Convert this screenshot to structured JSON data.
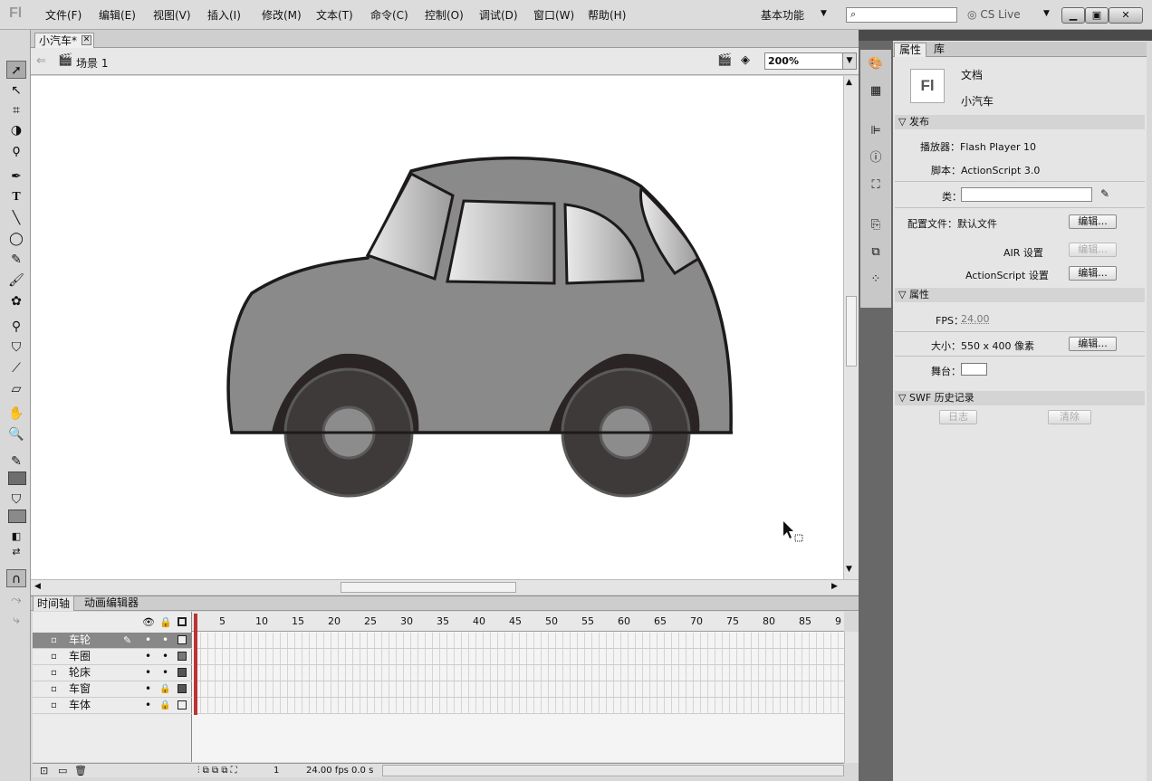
{
  "app": {
    "logo": "Fl"
  },
  "menu": [
    "文件(F)",
    "编辑(E)",
    "视图(V)",
    "插入(I)",
    "修改(M)",
    "文本(T)",
    "命令(C)",
    "控制(O)",
    "调试(D)",
    "窗口(W)",
    "帮助(H)"
  ],
  "workspace": {
    "label": "基本功能"
  },
  "search": {
    "placeholder": ""
  },
  "cslive": "CS Live",
  "document": {
    "tab": "小汽车*",
    "scene": "场景 1",
    "zoom": "200%"
  },
  "timeline": {
    "tabs": [
      "时间轴",
      "动画编辑器"
    ],
    "ruler": [
      "5",
      "10",
      "15",
      "20",
      "25",
      "30",
      "35",
      "40",
      "45",
      "50",
      "55",
      "60",
      "65",
      "70",
      "75",
      "80",
      "85",
      "9"
    ],
    "layers": [
      {
        "name": "车轮",
        "selected": true
      },
      {
        "name": "车圈",
        "selected": false
      },
      {
        "name": "轮床",
        "selected": false
      },
      {
        "name": "车窗",
        "selected": false
      },
      {
        "name": "车体",
        "selected": false
      }
    ],
    "footer": {
      "frame": "1",
      "fps": "24.00 fps",
      "time": "0.0 s"
    }
  },
  "properties": {
    "tabs": [
      "属性",
      "库"
    ],
    "doc_label": "文档",
    "doc_name": "小汽车",
    "doc_icon": "Fl",
    "publish_section": "发布",
    "player": "播放器：Flash Player 10",
    "script": "脚本：ActionScript 3.0",
    "class_label": "类：",
    "profile": "配置文件：默认文件",
    "edit": "编辑...",
    "air": "AIR 设置",
    "as_settings": "ActionScript 设置",
    "props_section": "属性",
    "fps_label": "FPS：",
    "fps_value": "24.00",
    "size": "大小：550 x 400 像素",
    "stage": "舞台：",
    "swf_section": "SWF 历史记录",
    "log": "日志",
    "clear": "清除"
  },
  "colors": {
    "car_body": "#8a8a8a",
    "wheel": "#3e3a3a",
    "hub": "#8c8c8c",
    "outline": "#1e1a1a"
  }
}
